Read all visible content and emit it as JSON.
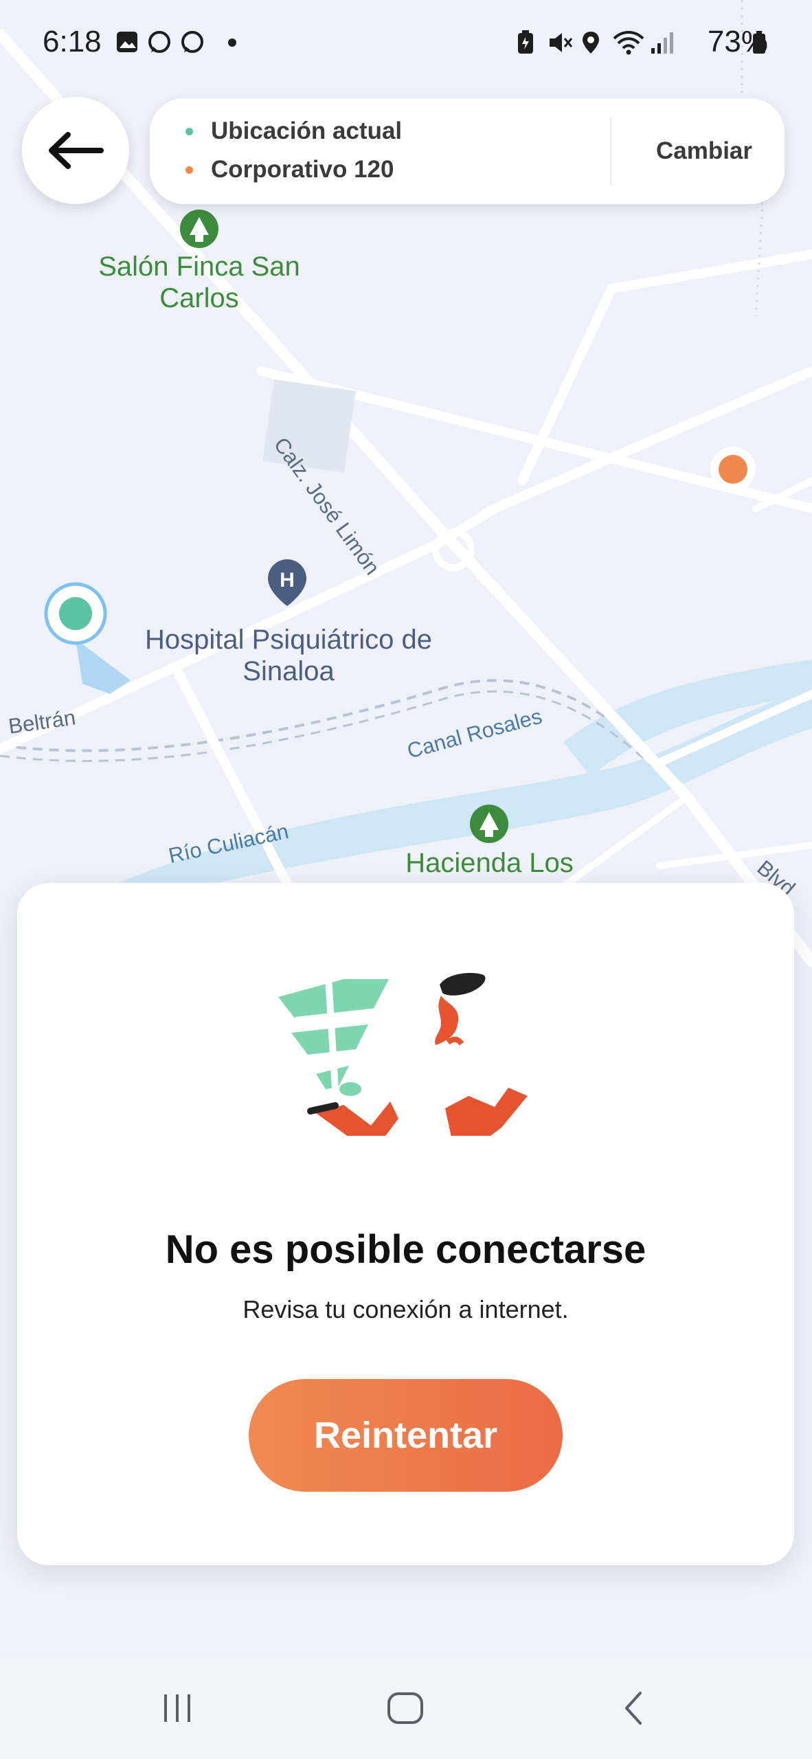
{
  "status_bar": {
    "time": "6:18",
    "battery": "73%",
    "left_icons": [
      "gallery-icon",
      "whatsapp-icon",
      "whatsapp-icon",
      "notification-dot-icon"
    ],
    "right_icons": [
      "battery-saver-icon",
      "mute-icon",
      "location-icon",
      "wifi-icon",
      "signal-icon",
      "battery-icon"
    ]
  },
  "header": {
    "back_icon": "arrow-left-icon",
    "origin": "Ubicación actual",
    "destination": "Corporativo 120",
    "change_label": "Cambiar",
    "origin_color": "#5cc2a4",
    "destination_color": "#f0884e"
  },
  "map": {
    "pois": {
      "salon": "Salón Finca San Carlos",
      "hospital": "Hospital Psiquiátrico de Sinaloa",
      "hacienda": "Hacienda Los"
    },
    "streets": {
      "calzada": "Calz. José Limón",
      "beltran": "Beltrán",
      "canal": "Canal Rosales",
      "rio": "Río Culiacán",
      "blvd": "Blvd"
    },
    "poi_icons": [
      "park-icon",
      "hospital-icon",
      "park-icon"
    ]
  },
  "dialog": {
    "title": "No es posible conectarse",
    "message": "Revisa tu conexión a internet.",
    "retry_label": "Reintentar",
    "accent_color": "#ee7a49"
  },
  "nav_bar": {
    "buttons": [
      "recent-apps-icon",
      "home-icon",
      "back-icon"
    ]
  }
}
